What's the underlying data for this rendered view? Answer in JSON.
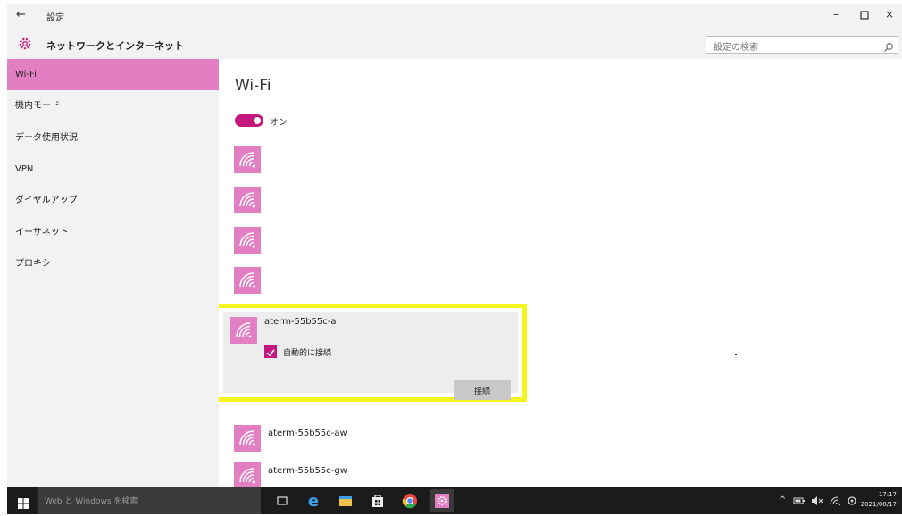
{
  "window": {
    "title": "設定",
    "back_glyph": "←",
    "controls": {
      "minimize": "–",
      "maximize": "▫",
      "close": "×"
    }
  },
  "header": {
    "title": "ネットワークとインターネット",
    "icon": "gear-icon",
    "search_placeholder": "設定の検索",
    "search_value": ""
  },
  "sidebar": {
    "items": [
      {
        "label": "Wi-Fi",
        "active": true
      },
      {
        "label": "機内モード"
      },
      {
        "label": "データ使用状況"
      },
      {
        "label": "VPN"
      },
      {
        "label": "ダイヤルアップ"
      },
      {
        "label": "イーサネット"
      },
      {
        "label": "プロキシ"
      }
    ]
  },
  "main": {
    "title": "Wi-Fi",
    "toggle_label": "オン",
    "toggle_on": true,
    "selected_network": {
      "name": "aterm-55b55c-a",
      "auto_connect_label": "自動的に接続",
      "auto_connect_checked": true,
      "connect_label": "接続"
    },
    "networks_below": [
      {
        "name": "aterm-55b55c-aw"
      },
      {
        "name": "aterm-55b55c-gw"
      }
    ]
  },
  "taskbar": {
    "search_placeholder": "Web と Windows を検索",
    "clock_time": "17:17",
    "clock_date": "2021/08/17"
  },
  "colors": {
    "accent": "#c3197f",
    "accent_light": "#e27fc3",
    "highlight": "#f4f41e",
    "taskbar": "#1b1b1b"
  }
}
